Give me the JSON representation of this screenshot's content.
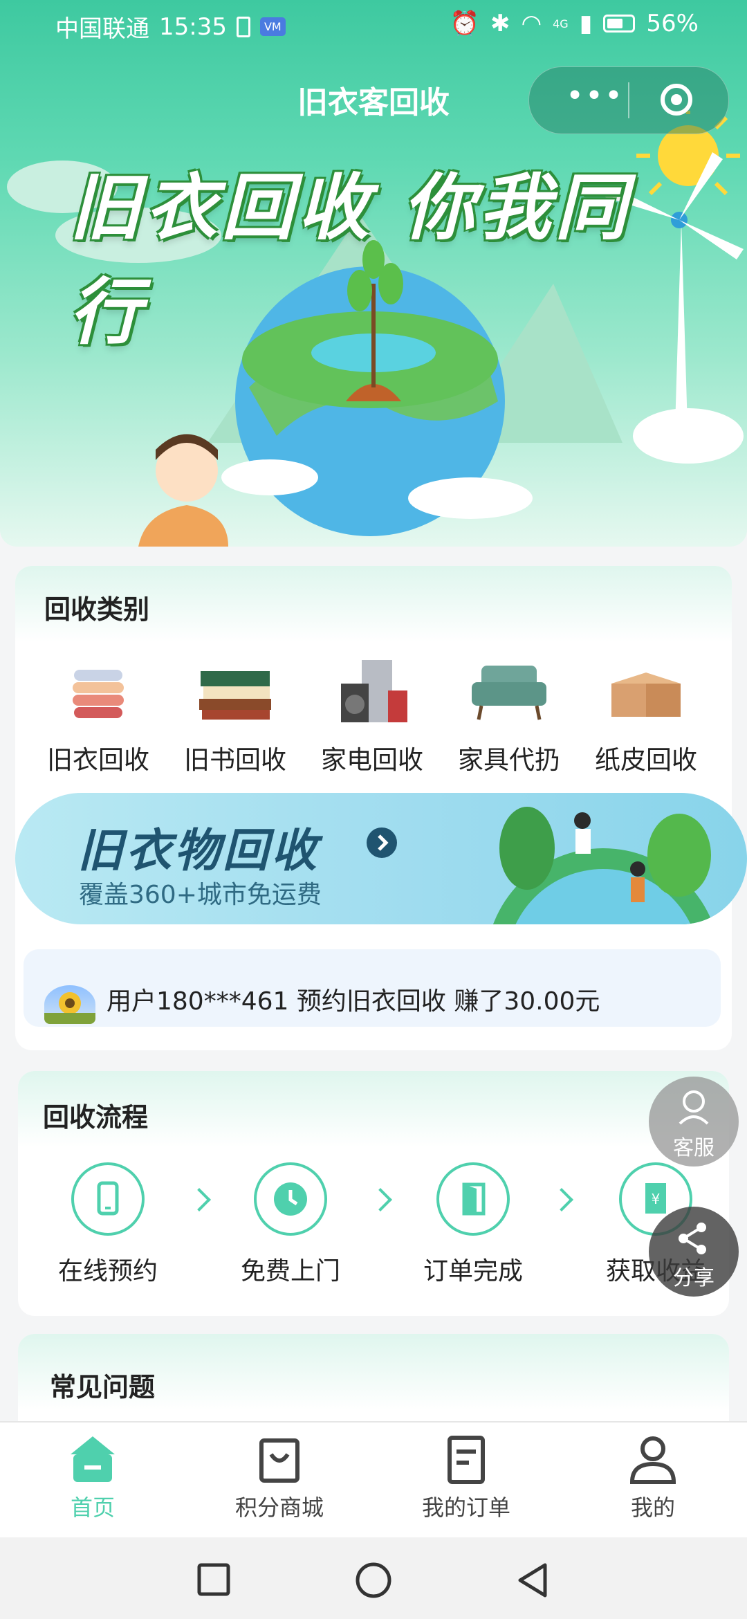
{
  "status_bar": {
    "carrier": "中国联通",
    "time": "15:35",
    "vm_badge": "VM",
    "network": "4G",
    "battery": "56%"
  },
  "header": {
    "title": "旧衣客回收",
    "more_label": "•••"
  },
  "hero": {
    "slogan": "旧衣回收 你我同行"
  },
  "categories": {
    "title": "回收类别",
    "items": [
      {
        "label": "旧衣回收"
      },
      {
        "label": "旧书回收"
      },
      {
        "label": "家电回收"
      },
      {
        "label": "家具代扔"
      },
      {
        "label": "纸皮回收"
      }
    ]
  },
  "banner": {
    "title": "旧衣物回收",
    "subtitle": "覆盖360+城市免运费"
  },
  "ticker": {
    "text": "用户180***461 预约旧衣回收 赚了30.00元"
  },
  "process": {
    "title": "回收流程",
    "steps": [
      {
        "label": "在线预约"
      },
      {
        "label": "免费上门"
      },
      {
        "label": "订单完成"
      },
      {
        "label": "获取收益"
      }
    ]
  },
  "faq": {
    "title": "常见问题"
  },
  "floating": {
    "service_label": "客服",
    "share_label": "分享"
  },
  "tabbar": {
    "items": [
      {
        "label": "首页",
        "icon": "home-icon",
        "active": true
      },
      {
        "label": "积分商城",
        "icon": "shopping-bag-icon",
        "active": false
      },
      {
        "label": "我的订单",
        "icon": "document-icon",
        "active": false
      },
      {
        "label": "我的",
        "icon": "user-icon",
        "active": false
      }
    ]
  },
  "colors": {
    "accent": "#4fd0ad",
    "hero_top": "#3ec9a0",
    "banner_text": "#1f5470"
  }
}
